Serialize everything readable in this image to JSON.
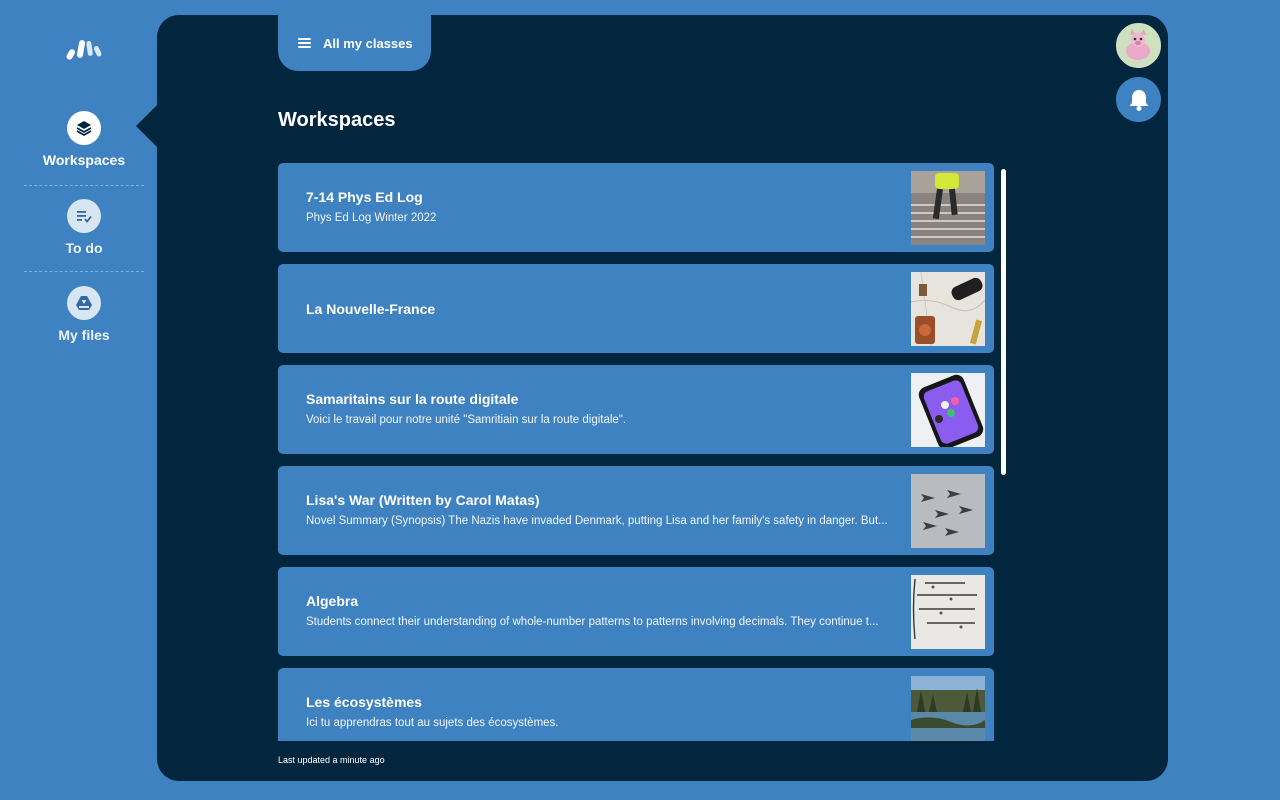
{
  "sidebar": {
    "items": [
      {
        "label": "Workspaces",
        "icon": "layers-icon",
        "active": true
      },
      {
        "label": "To do",
        "icon": "checklist-icon",
        "active": false
      },
      {
        "label": "My files",
        "icon": "drive-icon",
        "active": false
      }
    ]
  },
  "header": {
    "class_selector_label": "All my classes",
    "page_title": "Workspaces"
  },
  "workspaces": [
    {
      "title": "7-14 Phys Ed Log",
      "description": "Phys Ed Log Winter 2022",
      "thumbnail": "stairs-running-photo"
    },
    {
      "title": "La Nouvelle-France",
      "description": "",
      "thumbnail": "map-and-compass-photo"
    },
    {
      "title": "Samaritains sur la route digitale",
      "description": "Voici le travail pour notre unité \"Samritiain sur la route digitale\".",
      "thumbnail": "smartphone-photo"
    },
    {
      "title": "Lisa's War (Written by Carol Matas)",
      "description": "Novel Summary (Synopsis) The Nazis have invaded Denmark, putting Lisa and her family's safety in danger. But...",
      "thumbnail": "fighter-jets-photo"
    },
    {
      "title": "Algebra",
      "description": "Students connect their understanding of whole-number patterns to patterns involving decimals. They continue t...",
      "thumbnail": "equations-photo"
    },
    {
      "title": "Les écosystèmes",
      "description": "Ici tu apprendras tout au sujets des écosystèmes.",
      "thumbnail": "lake-forest-photo"
    }
  ],
  "footer": {
    "last_updated": "Last updated a minute ago"
  },
  "colors": {
    "background": "#3f82c2",
    "panel": "#03263f",
    "card": "#3f82c2"
  }
}
